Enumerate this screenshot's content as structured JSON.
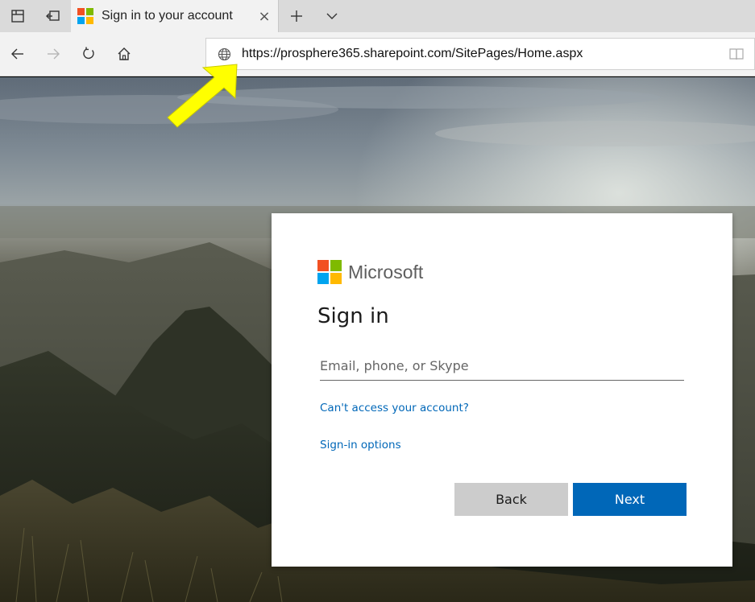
{
  "browser": {
    "tab": {
      "title": "Sign in to your account",
      "close_glyph": "×"
    },
    "new_tab_glyph": "+",
    "address": {
      "url": "https://prosphere365.sharepoint.com/SitePages/Home.aspx"
    },
    "icons": {
      "tab_preview": "tab-preview-icon",
      "set_aside_tabs": "set-aside-tabs-icon",
      "back": "back-arrow-icon",
      "forward": "forward-arrow-icon",
      "refresh": "refresh-icon",
      "home": "home-icon",
      "site_info": "globe-icon",
      "reading_view": "reading-view-icon",
      "tab_list": "chevron-down-icon"
    }
  },
  "signin": {
    "brand": "Microsoft",
    "title": "Sign in",
    "email_placeholder": "Email, phone, or Skype",
    "cant_access_link": "Can't access your account?",
    "signin_options_link": "Sign-in options",
    "back_button": "Back",
    "next_button": "Next"
  },
  "colors": {
    "ms_red": "#f25022",
    "ms_green": "#7fba00",
    "ms_blue": "#00a4ef",
    "ms_yellow": "#ffb900",
    "accent_blue": "#0067b8",
    "annotation_arrow": "#ffff00"
  }
}
